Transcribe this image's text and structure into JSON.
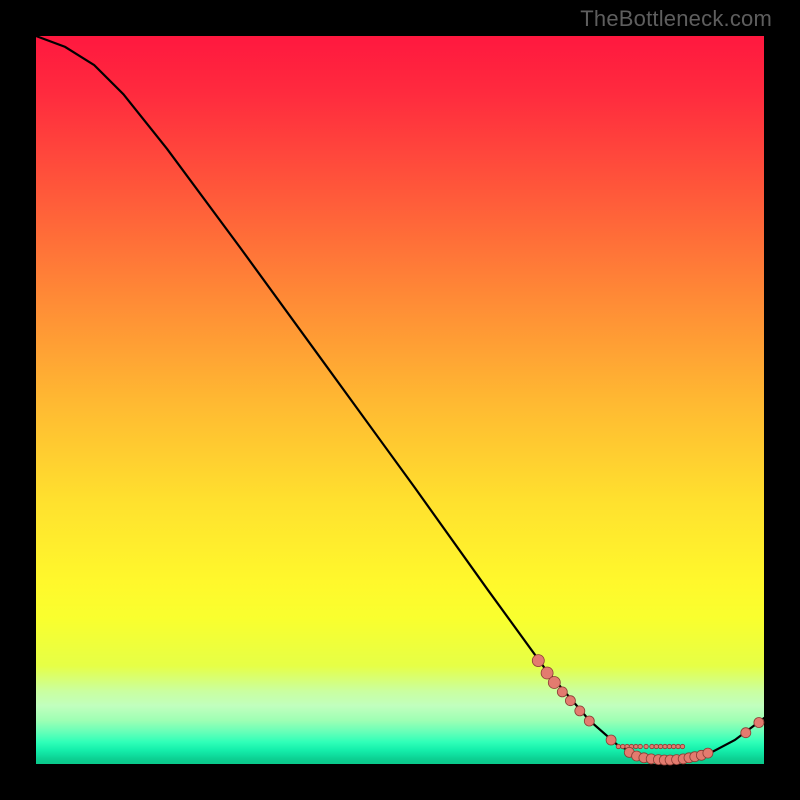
{
  "watermark": "TheBottleneck.com",
  "colors": {
    "point_fill": "#e37b6f",
    "point_stroke": "#8b3d35",
    "line": "#000000"
  },
  "chart_data": {
    "type": "line",
    "title": "",
    "xlabel": "",
    "ylabel": "",
    "xlim": [
      0,
      100
    ],
    "ylim": [
      0,
      100
    ],
    "curve": [
      {
        "x": 0,
        "y": 100
      },
      {
        "x": 4,
        "y": 98.5
      },
      {
        "x": 8,
        "y": 96
      },
      {
        "x": 12,
        "y": 92
      },
      {
        "x": 18,
        "y": 84.5
      },
      {
        "x": 28,
        "y": 71
      },
      {
        "x": 40,
        "y": 54.5
      },
      {
        "x": 52,
        "y": 38
      },
      {
        "x": 62,
        "y": 24
      },
      {
        "x": 70,
        "y": 13
      },
      {
        "x": 76,
        "y": 6
      },
      {
        "x": 80,
        "y": 2.5
      },
      {
        "x": 84,
        "y": 0.8
      },
      {
        "x": 88,
        "y": 0.5
      },
      {
        "x": 92,
        "y": 1.2
      },
      {
        "x": 96,
        "y": 3.3
      },
      {
        "x": 100,
        "y": 6.3
      }
    ],
    "points_main": [
      {
        "x": 69.0,
        "y": 14.2,
        "r": 6
      },
      {
        "x": 70.2,
        "y": 12.5,
        "r": 6
      },
      {
        "x": 71.2,
        "y": 11.2,
        "r": 6
      },
      {
        "x": 72.3,
        "y": 9.9,
        "r": 5
      },
      {
        "x": 73.4,
        "y": 8.7,
        "r": 5
      },
      {
        "x": 74.7,
        "y": 7.3,
        "r": 5
      },
      {
        "x": 76.0,
        "y": 5.9,
        "r": 5
      },
      {
        "x": 79.0,
        "y": 3.3,
        "r": 5
      },
      {
        "x": 81.5,
        "y": 1.6,
        "r": 5
      },
      {
        "x": 82.5,
        "y": 1.1,
        "r": 5
      },
      {
        "x": 83.5,
        "y": 0.85,
        "r": 5
      },
      {
        "x": 84.5,
        "y": 0.7,
        "r": 5
      },
      {
        "x": 85.5,
        "y": 0.6,
        "r": 5
      },
      {
        "x": 86.3,
        "y": 0.55,
        "r": 5
      },
      {
        "x": 87.1,
        "y": 0.55,
        "r": 5
      },
      {
        "x": 88.0,
        "y": 0.6,
        "r": 5
      },
      {
        "x": 88.9,
        "y": 0.7,
        "r": 5
      },
      {
        "x": 89.7,
        "y": 0.85,
        "r": 5
      },
      {
        "x": 90.5,
        "y": 1.0,
        "r": 5
      },
      {
        "x": 91.4,
        "y": 1.2,
        "r": 5
      },
      {
        "x": 92.3,
        "y": 1.5,
        "r": 5
      },
      {
        "x": 97.5,
        "y": 4.3,
        "r": 5
      },
      {
        "x": 99.3,
        "y": 5.7,
        "r": 5
      }
    ],
    "points_label_strip": [
      {
        "x": 80.0,
        "y": 2.4,
        "r": 2.2
      },
      {
        "x": 80.6,
        "y": 2.4,
        "r": 2.2
      },
      {
        "x": 81.2,
        "y": 2.4,
        "r": 2.2
      },
      {
        "x": 81.8,
        "y": 2.4,
        "r": 2.2
      },
      {
        "x": 82.4,
        "y": 2.4,
        "r": 2.2
      },
      {
        "x": 83.0,
        "y": 2.4,
        "r": 2.2
      },
      {
        "x": 83.8,
        "y": 2.4,
        "r": 2.2
      },
      {
        "x": 84.6,
        "y": 2.4,
        "r": 2.2
      },
      {
        "x": 85.2,
        "y": 2.4,
        "r": 2.2
      },
      {
        "x": 85.8,
        "y": 2.4,
        "r": 2.2
      },
      {
        "x": 86.4,
        "y": 2.4,
        "r": 2.2
      },
      {
        "x": 87.0,
        "y": 2.4,
        "r": 2.2
      },
      {
        "x": 87.6,
        "y": 2.4,
        "r": 2.2
      },
      {
        "x": 88.2,
        "y": 2.4,
        "r": 2.2
      },
      {
        "x": 88.8,
        "y": 2.4,
        "r": 2.2
      }
    ]
  }
}
